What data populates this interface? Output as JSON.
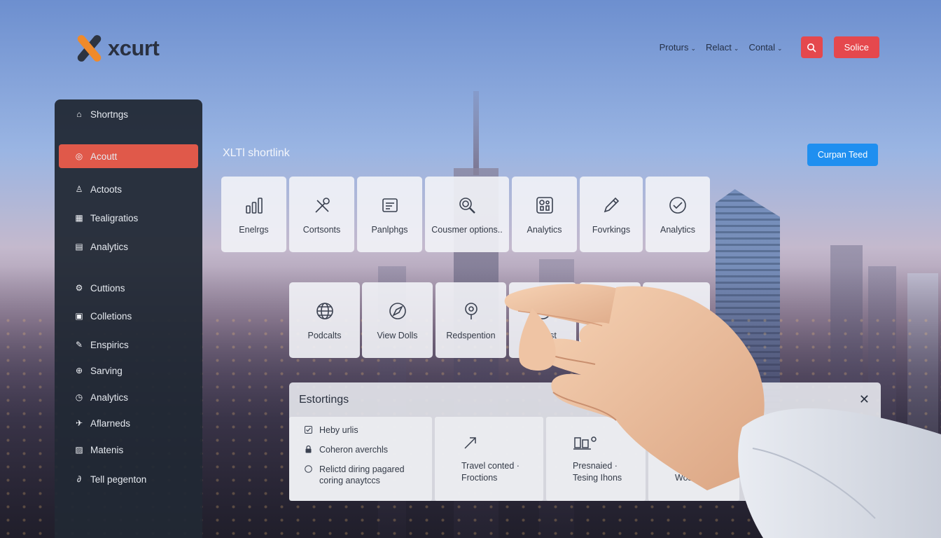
{
  "brand": {
    "name": "xcurt"
  },
  "nav": {
    "items": [
      {
        "label": "Proturs"
      },
      {
        "label": "Relact"
      },
      {
        "label": "Contal"
      }
    ],
    "action_label": "Solice"
  },
  "sidebar": {
    "items": [
      {
        "label": "Shortngs",
        "icon": "home-icon"
      },
      {
        "label": "Acoutt",
        "icon": "account-icon",
        "active": true
      },
      {
        "label": "Actoots",
        "icon": "user-icon"
      },
      {
        "label": "Tealigratios",
        "icon": "grid-icon"
      },
      {
        "label": "Analytics",
        "icon": "chart-icon"
      },
      {
        "label": "Cuttions",
        "icon": "gear-icon"
      },
      {
        "label": "Colletions",
        "icon": "collection-icon"
      },
      {
        "label": "Enspirics",
        "icon": "pen-icon"
      },
      {
        "label": "Sarving",
        "icon": "globe-icon"
      },
      {
        "label": "Analytics",
        "icon": "clock-icon"
      },
      {
        "label": "Aflarneds",
        "icon": "bird-icon"
      },
      {
        "label": "Matenis",
        "icon": "image-icon"
      },
      {
        "label": "Tell pegenton",
        "icon": "link-icon"
      }
    ]
  },
  "main": {
    "title": "XLTl shortlink",
    "primary_label": "Curpan Teed",
    "tiles_row1": [
      {
        "label": "Enelrgs",
        "icon": "bar-chart-icon"
      },
      {
        "label": "Cortsonts",
        "icon": "tools-icon"
      },
      {
        "label": "Panlphgs",
        "icon": "document-icon"
      },
      {
        "label": "Cousmer options..",
        "icon": "magnifier-icon"
      },
      {
        "label": "Analytics",
        "icon": "dashboard-icon"
      },
      {
        "label": "Fovrkings",
        "icon": "pencil-icon"
      },
      {
        "label": "Analytics",
        "icon": "check-circle-icon"
      }
    ],
    "tiles_row2": [
      {
        "label": "Podcalts",
        "icon": "globe-icon"
      },
      {
        "label": "View Dolls",
        "icon": "compass-icon"
      },
      {
        "label": "Redspention",
        "icon": "pin-icon"
      },
      {
        "label": "Drtasst",
        "icon": "network-icon"
      },
      {
        "label": "",
        "icon": ""
      },
      {
        "label": "",
        "icon": ""
      }
    ]
  },
  "panel": {
    "title": "Estortings",
    "checks": [
      {
        "label": "Heby urlis",
        "type": "checkbox"
      },
      {
        "label": "Coheron averchls",
        "type": "lock"
      },
      {
        "label": "Relictd diring pagared\ncoring anaytccs",
        "type": "radio"
      }
    ],
    "cards": [
      {
        "label": "Travel conted ·\nFroctions",
        "icon": "arrow-icon"
      },
      {
        "label": "Presnaied ·\nTesing Ihons",
        "icon": "cart-icon"
      },
      {
        "label": "Dl\nWosc ti",
        "icon": "doc-icon"
      }
    ]
  }
}
